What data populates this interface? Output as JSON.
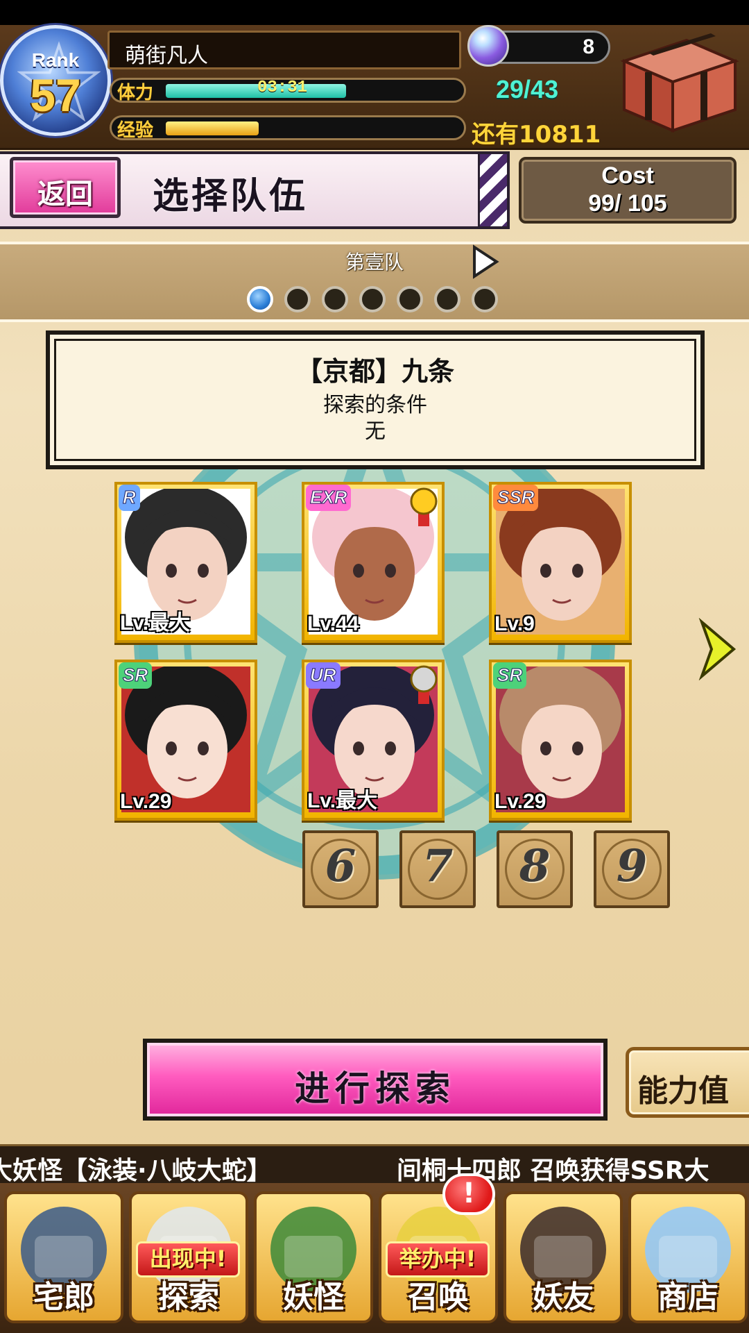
{
  "header": {
    "rank_label": "Rank",
    "rank_value": "57",
    "player_name": "萌街凡人",
    "stamina_label": "体力",
    "stamina_timer": "03:31",
    "stamina_fill": 0.62,
    "exp_label": "经验",
    "exp_fill": 0.32,
    "gem_count": "8",
    "stamina_value": "29/43",
    "exp_remaining": "还有10811"
  },
  "title_row": {
    "back_label": "返回",
    "title": "选择队伍",
    "cost_label": "Cost",
    "cost_value": "99/ 105"
  },
  "team": {
    "name": "第壹队",
    "page_count": 7,
    "active_index": 0
  },
  "area": {
    "name": "【京都】九条",
    "condition_label": "探索的条件",
    "condition_value": "无"
  },
  "cards": [
    {
      "rarity": "R",
      "level": "Lv.最大",
      "rarity_color": "#6fa8ff"
    },
    {
      "rarity": "EXR",
      "level": "Lv.44",
      "rarity_color": "#ff6ad0",
      "medal": "gold"
    },
    {
      "rarity": "SSR",
      "level": "Lv.9",
      "rarity_color": "#ff8a3d"
    },
    {
      "rarity": "SR",
      "level": "Lv.29",
      "rarity_color": "#4dd27a"
    },
    {
      "rarity": "UR",
      "level": "Lv.最大",
      "rarity_color": "#8a7aff",
      "medal": "silver"
    },
    {
      "rarity": "SR",
      "level": "Lv.29",
      "rarity_color": "#4dd27a"
    }
  ],
  "slots": [
    "6",
    "7",
    "8",
    "9"
  ],
  "actions": {
    "explore_label": "进行探索",
    "ability_label": "能力值"
  },
  "ticker": {
    "left_text": "大妖怪【泳装·八岐大蛇】",
    "right_text": "间桐十四郎 召唤获得SSR大"
  },
  "nav": {
    "items": [
      {
        "label": "宅郎",
        "icon": "house-icon"
      },
      {
        "label": "探索",
        "icon": "map-icon",
        "badge": "出现中!"
      },
      {
        "label": "妖怪",
        "icon": "scroll-icon"
      },
      {
        "label": "召唤",
        "icon": "star-icon",
        "badge": "举办中!"
      },
      {
        "label": "妖友",
        "icon": "friend-icon"
      },
      {
        "label": "商店",
        "icon": "crystal-ball-icon"
      }
    ],
    "alert_badge": "!"
  },
  "colors": {
    "accent_pink": "#e13a9a",
    "stamina_teal": "#4ff2d4",
    "gold": "#ffd53a"
  }
}
